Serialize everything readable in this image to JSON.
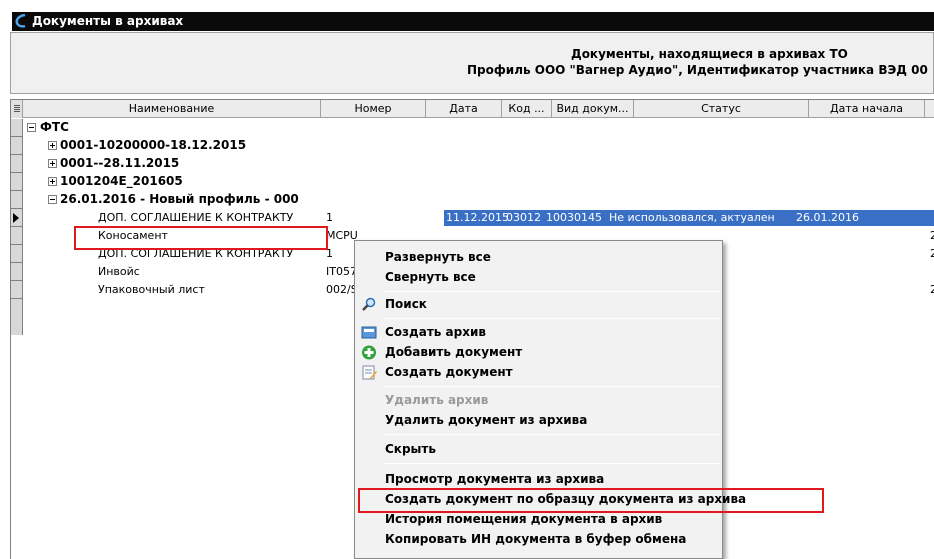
{
  "window": {
    "title": "Документы в архивах"
  },
  "header": {
    "line1": "Документы, находящиеся в архивах ТО",
    "line2": "Профиль ООО \"Вагнер Аудио\", Идентификатор участника ВЭД 00"
  },
  "columns": [
    "Наименование",
    "Номер",
    "Дата",
    "Код ...",
    "Вид докум...",
    "Статус",
    "Дата начала"
  ],
  "tree": {
    "root": "ФТС",
    "archives": [
      "0001-10200000-18.12.2015",
      "0001--28.11.2015",
      "1001204E_201605"
    ],
    "open_archive": "26.01.2016 - Новый профиль - 000",
    "documents": [
      {
        "name": "ДОП. СОГЛАШЕНИЕ К КОНТРАКТУ",
        "number": "1",
        "right": "2"
      },
      {
        "name": "Коносамент",
        "number": "MCPU",
        "right": "2"
      },
      {
        "name": "ДОП. СОГЛАШЕНИЕ К КОНТРАКТУ",
        "number": "1",
        "right": "2"
      },
      {
        "name": "Инвойс",
        "number": "IT057",
        "right": ""
      },
      {
        "name": "Упаковочный лист",
        "number": "002/S",
        "right": "2"
      }
    ],
    "selected_row_values": {
      "date": "11.12.2015",
      "code": "03012",
      "doc_kind": "10030145",
      "status": "Не использовался, актуален",
      "start_date": "26.01.2016",
      "extra": "2"
    }
  },
  "context_menu": {
    "items": [
      {
        "label": "Развернуть все",
        "icon": "",
        "enabled": true
      },
      {
        "label": "Свернуть все",
        "icon": "",
        "enabled": true
      },
      {
        "label": "Поиск",
        "icon": "search-icon",
        "enabled": true
      },
      {
        "label": "Создать архив",
        "icon": "create-archive-icon",
        "enabled": true
      },
      {
        "label": "Добавить документ",
        "icon": "add-icon",
        "enabled": true
      },
      {
        "label": "Создать документ",
        "icon": "create-document-icon",
        "enabled": true
      },
      {
        "label": "Удалить архив",
        "icon": "",
        "enabled": false
      },
      {
        "label": "Удалить документ из архива",
        "icon": "",
        "enabled": true
      },
      {
        "label": "Скрыть",
        "icon": "",
        "enabled": true
      },
      {
        "label": "Просмотр документа из архива",
        "icon": "",
        "enabled": true
      },
      {
        "label": "Создать документ по образцу документа из архива",
        "icon": "",
        "enabled": true
      },
      {
        "label": "История помещения документа в архив",
        "icon": "",
        "enabled": true
      },
      {
        "label": "Копировать ИН документа в буфер обмена",
        "icon": "",
        "enabled": true
      }
    ]
  },
  "colors": {
    "selection": "#3a6fc6",
    "highlight": "#e0191d",
    "titlebar": "#0a0a0a"
  }
}
